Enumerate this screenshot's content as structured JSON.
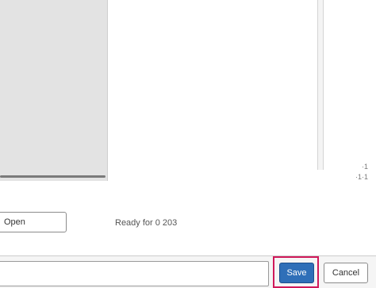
{
  "dialog": {
    "side_marks": [
      "·1",
      "·1·1"
    ],
    "open_button_label": "Open",
    "status_text": "Ready for 0 203",
    "filename_value": "",
    "save_label": "Save",
    "cancel_label": "Cancel"
  },
  "colors": {
    "accent": "#2f6fb8",
    "highlight": "#d0195a",
    "panel": "#e3e3e3"
  }
}
